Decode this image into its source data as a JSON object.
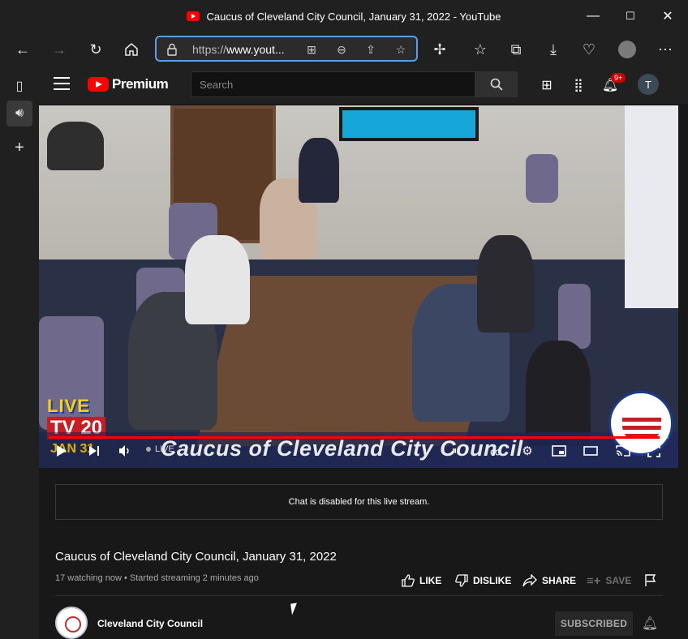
{
  "window": {
    "title": "Caucus of Cleveland City Council, January 31, 2022 - YouTube",
    "minimize": "—",
    "maximize": "☐",
    "close": "✕"
  },
  "browser": {
    "url_prefix": "https://",
    "url_host": "www.yout...",
    "buttons": [
      "back",
      "forward",
      "refresh",
      "home"
    ],
    "toolbar_icons": [
      "extensions-icon",
      "favorites-icon",
      "collections-icon",
      "downloads-icon",
      "profile-icon",
      "more-icon"
    ]
  },
  "youtube": {
    "logo_text": "Premium",
    "search_placeholder": "Search",
    "notification_count": "9+",
    "account_initial": "T"
  },
  "player": {
    "overlay_text": "Caucus of Cleveland City Council",
    "live_label": "LIVE",
    "station_top": "LIVE",
    "station_bottom": "TV 20",
    "date_overlay": "JAN 31",
    "progress": 0.985
  },
  "chat": {
    "message": "Chat is disabled for this live stream."
  },
  "video": {
    "title": "Caucus of Cleveland City Council, January 31, 2022",
    "meta": "17 watching now • Started streaming 2 minutes ago",
    "like": "LIKE",
    "dislike": "DISLIKE",
    "share": "SHARE",
    "save": "SAVE"
  },
  "channel": {
    "name": "Cleveland City Council",
    "subscribe_label": "SUBSCRIBED"
  },
  "colors": {
    "accent_red": "#ff0000",
    "focus_blue": "#5a9fe8"
  }
}
